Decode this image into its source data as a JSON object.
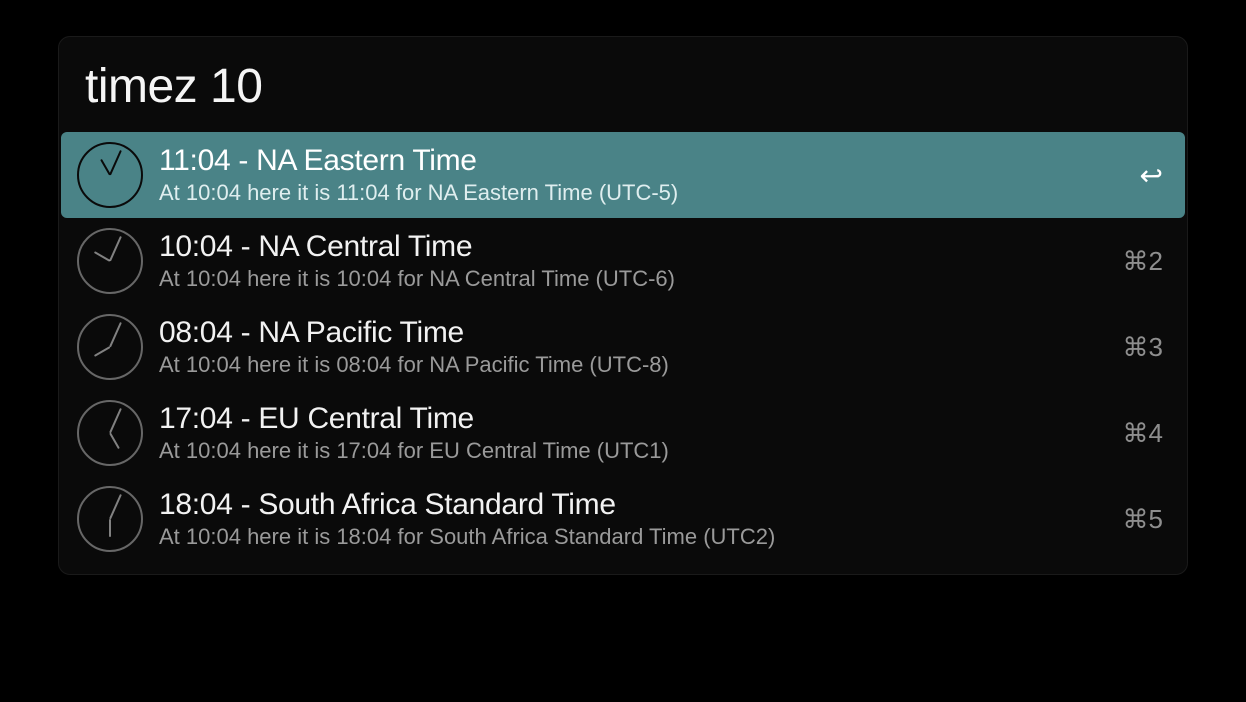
{
  "search": {
    "value": "timez 10"
  },
  "results": [
    {
      "title": "11:04 - NA Eastern Time",
      "subtitle": "At 10:04 here it is 11:04 for NA Eastern Time (UTC-5)",
      "shortcut": "↩",
      "selected": true,
      "hourAngle": 330,
      "minuteAngle": 24,
      "icon": "clock-icon"
    },
    {
      "title": "10:04 - NA Central Time",
      "subtitle": "At 10:04 here it is 10:04 for NA Central Time (UTC-6)",
      "shortcut": "⌘2",
      "selected": false,
      "hourAngle": 300,
      "minuteAngle": 24,
      "icon": "clock-icon"
    },
    {
      "title": "08:04 - NA Pacific Time",
      "subtitle": "At 10:04 here it is 08:04 for NA Pacific Time (UTC-8)",
      "shortcut": "⌘3",
      "selected": false,
      "hourAngle": 240,
      "minuteAngle": 24,
      "icon": "clock-icon"
    },
    {
      "title": "17:04 - EU Central Time",
      "subtitle": "At 10:04 here it is 17:04 for EU Central Time (UTC1)",
      "shortcut": "⌘4",
      "selected": false,
      "hourAngle": 150,
      "minuteAngle": 24,
      "icon": "clock-icon"
    },
    {
      "title": "18:04 - South Africa Standard Time",
      "subtitle": "At 10:04 here it is 18:04 for South Africa Standard Time (UTC2)",
      "shortcut": "⌘5",
      "selected": false,
      "hourAngle": 180,
      "minuteAngle": 24,
      "icon": "clock-icon"
    }
  ]
}
